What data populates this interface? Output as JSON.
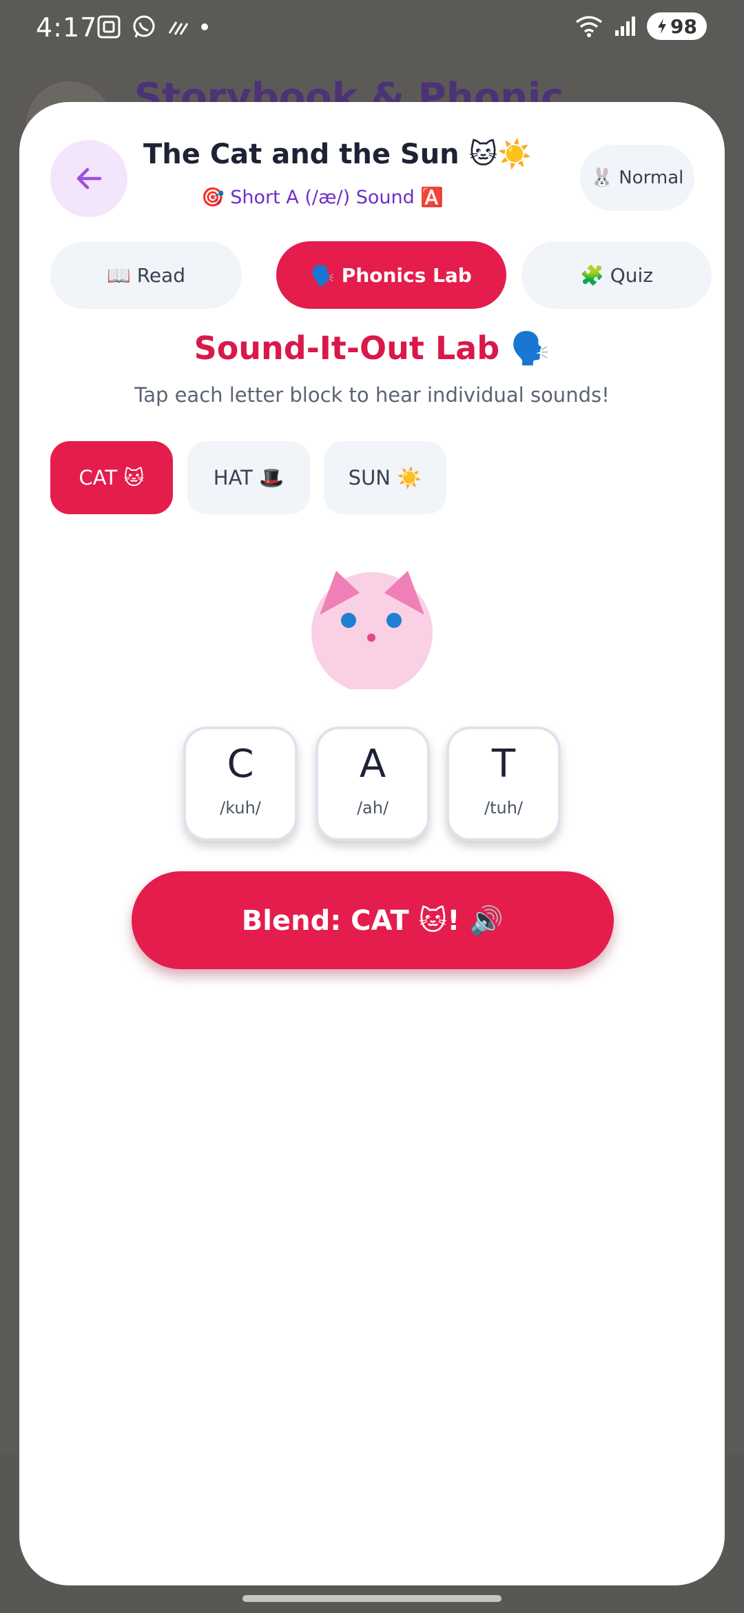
{
  "status_bar": {
    "time": "4:17",
    "battery": "98",
    "icons": [
      "screenshot-icon",
      "whatsapp-icon",
      "signal-lines-icon",
      "dot-icon",
      "wifi-icon",
      "cell-signal-icon",
      "battery-bolt-icon"
    ]
  },
  "background": {
    "title": "Storybook & Phonics 📚"
  },
  "header": {
    "title": "The Cat and the Sun 🐱☀️",
    "subtitle": "🎯 Short A (/æ/) Sound 🅰️",
    "mode_label": "🐰 Normal"
  },
  "tabs": [
    {
      "label": "📖 Read",
      "active": false
    },
    {
      "label": "🗣️ Phonics Lab",
      "active": true
    },
    {
      "label": "🧩 Quiz",
      "active": false
    }
  ],
  "lab": {
    "title": "Sound-It-Out Lab 🗣️",
    "instruction": "Tap each letter block to hear individual sounds!"
  },
  "words": [
    {
      "label": "CAT 🐱",
      "active": true
    },
    {
      "label": "HAT 🎩",
      "active": false
    },
    {
      "label": "SUN ☀️",
      "active": false
    }
  ],
  "letters": [
    {
      "char": "C",
      "sound": "/kuh/"
    },
    {
      "char": "A",
      "sound": "/ah/"
    },
    {
      "char": "T",
      "sound": "/tuh/"
    }
  ],
  "blend_button": "Blend: CAT 🐱! 🔊",
  "colors": {
    "accent": "#e41d4c",
    "purple": "#6d2fc9",
    "chip_bg": "#f1f4f8",
    "cat_face": "#fad0e4",
    "cat_ear": "#f07fb8",
    "cat_eye": "#1f7fd0"
  }
}
